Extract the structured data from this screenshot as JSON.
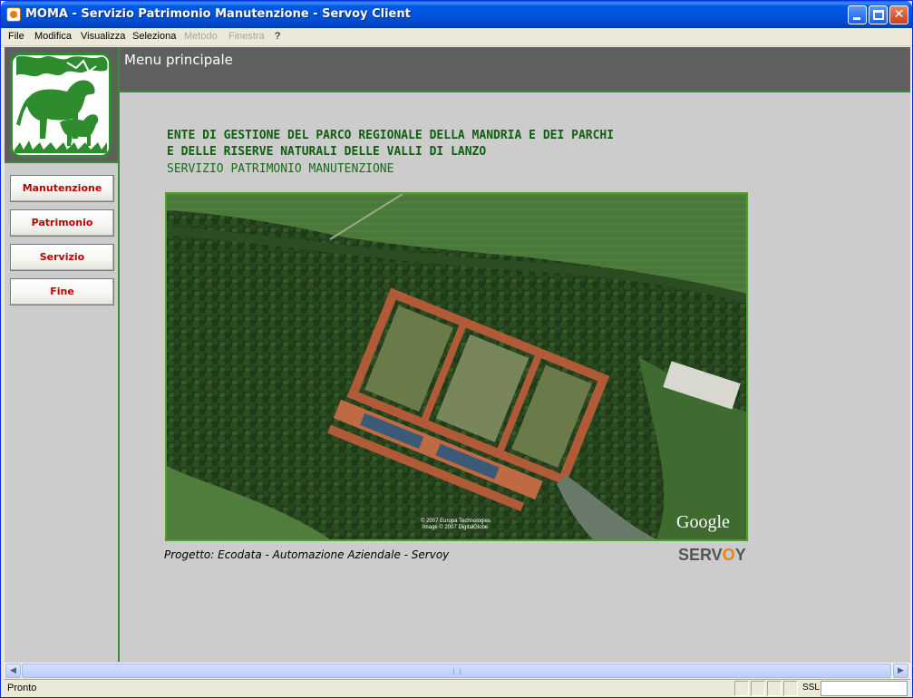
{
  "window": {
    "title": "MOMA - Servizio Patrimonio Manutenzione - Servoy Client"
  },
  "menubar": {
    "items": [
      {
        "label": "File",
        "enabled": true
      },
      {
        "label": "Modifica",
        "enabled": true
      },
      {
        "label": "Visualizza",
        "enabled": true
      },
      {
        "label": "Seleziona",
        "enabled": true
      },
      {
        "label": "Metodo",
        "enabled": false
      },
      {
        "label": "Finestra",
        "enabled": false
      },
      {
        "label": "?",
        "enabled": true
      }
    ]
  },
  "sidebar": {
    "buttons": [
      {
        "label": "Manutenzione"
      },
      {
        "label": "Patrimonio"
      },
      {
        "label": "Servizio"
      },
      {
        "label": "Fine"
      }
    ]
  },
  "header": {
    "title": "Menu principale"
  },
  "main": {
    "org_line_1": "ENTE DI GESTIONE DEL PARCO REGIONALE DELLA MANDRIA E DEI PARCHI",
    "org_line_2": "E DELLE RISERVE NATURALI DELLE VALLI DI LANZO",
    "org_line_3": "SERVIZIO PATRIMONIO MANUTENZIONE",
    "photo_credit_1": "© 2007 Europa Technologies",
    "photo_credit_2": "Image © 2007 DigitalGlobe",
    "photo_brand": "Google",
    "project_text": "Progetto: Ecodata - Automazione Aziendale - Servoy",
    "servoy_logo_a": "SERV",
    "servoy_logo_o": "O",
    "servoy_logo_b": "Y"
  },
  "statusbar": {
    "text": "Pronto",
    "ssl": "SSL"
  },
  "colors": {
    "accent_green": "#3a8a3a",
    "button_text": "#c00000",
    "header_bg": "#606060"
  }
}
